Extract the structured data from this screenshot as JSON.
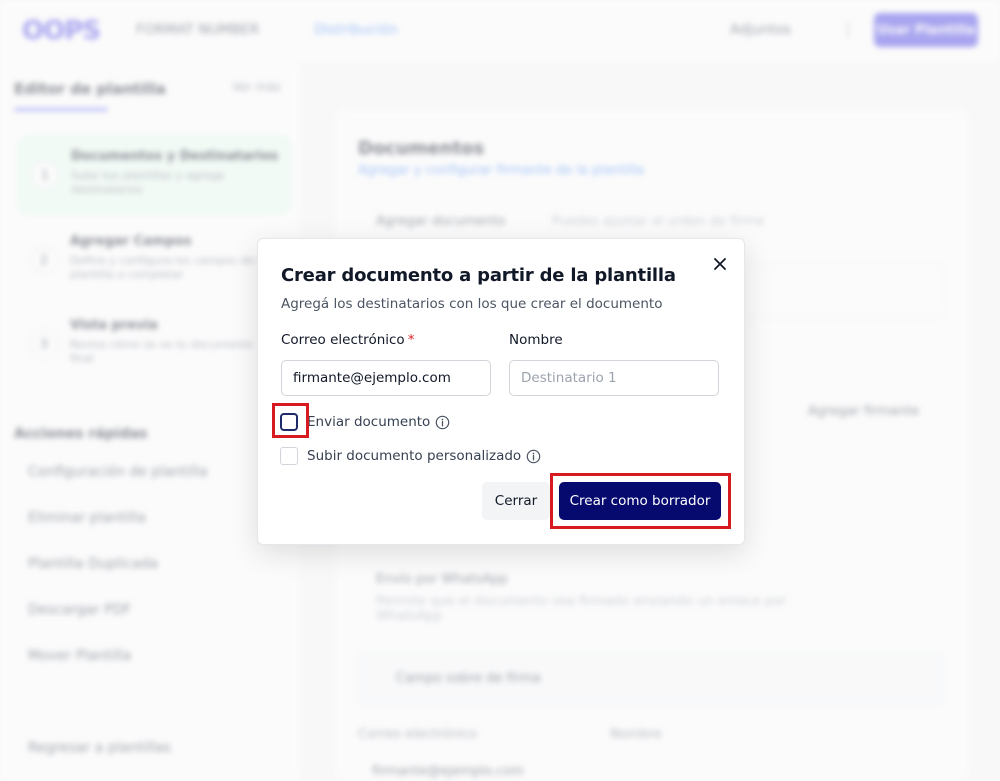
{
  "app": {
    "logo": "OOPS",
    "template_title": "FORMAT NUMBER",
    "nav_link": "Distribución",
    "top_right": "Adjuntos",
    "top_button": "Usar Plantilla"
  },
  "sidebar": {
    "header": "Editor de plantilla",
    "header_link": "Ver más",
    "steps": [
      {
        "num": "1",
        "title": "Documentos y Destinatarios",
        "desc": "Sube tus plantillas y agrega destinatarios"
      },
      {
        "num": "2",
        "title": "Agregar Campos",
        "desc": "Define y configura los campos de la plantilla a completar"
      },
      {
        "num": "3",
        "title": "Vista previa",
        "desc": "Revisa cómo se ve tu documento final"
      }
    ],
    "section_title": "Acciones rápidas",
    "items": [
      "Configuración de plantilla",
      "Eliminar plantilla",
      "Plantilla Duplicada",
      "Descargar PDF",
      "Mover Plantilla"
    ],
    "back": "Regresar a plantillas"
  },
  "main": {
    "title": "Documentos",
    "subtitle": "Agregar y configurar firmante de la plantilla",
    "add_document": "Agregar documento",
    "add_document_hint": "Puedes ajustar el orden de firma",
    "add_signer": "Agregar firmante",
    "whatsapp_title": "Envío por WhatsApp",
    "whatsapp_desc": "Permite que el documento sea firmado enviando un enlace por WhatsApp",
    "field_label": "Campo sobre de firma",
    "col_email": "Correo electrónico",
    "col_name": "Nombre",
    "row_email": "firmante@ejemplo.com"
  },
  "modal": {
    "title": "Crear documento a partir de la plantilla",
    "subtitle": "Agregá los destinatarios con los que crear el documento",
    "email_label": "Correo electrónico",
    "required_mark": "*",
    "email_value": "firmante@ejemplo.com",
    "name_label": "Nombre",
    "name_placeholder": "Destinatario 1",
    "send_document_label": "Enviar documento",
    "upload_custom_label": "Subir documento personalizado",
    "cancel_label": "Cerrar",
    "submit_label": "Crear como borrador"
  }
}
